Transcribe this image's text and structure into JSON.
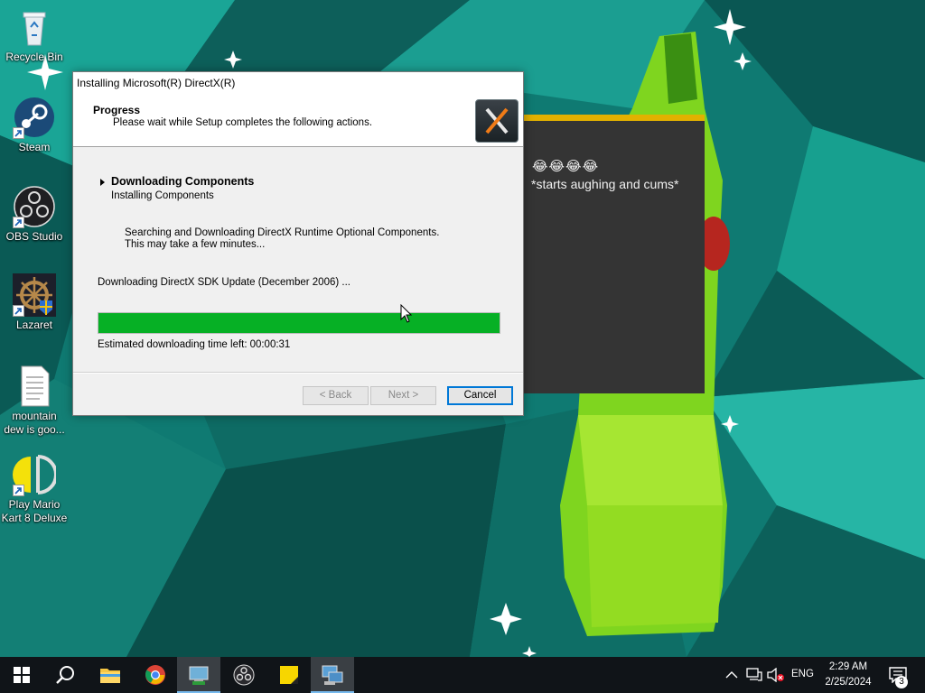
{
  "desktop": {
    "icons": [
      {
        "label": "Recycle Bin",
        "shortcut": false
      },
      {
        "label": "Steam",
        "shortcut": true
      },
      {
        "label": "OBS Studio",
        "shortcut": true
      },
      {
        "label": "Lazaret",
        "shortcut": true
      },
      {
        "label_line1": "mountain",
        "label_line2": "dew is goo...",
        "shortcut": false
      },
      {
        "label_line1": "Play Mario",
        "label_line2": "Kart 8 Deluxe",
        "shortcut": true
      }
    ]
  },
  "chat_popup": {
    "emojis": "😂😂😂😂",
    "message": "*starts aughing and cums*",
    "accent_color": "#e2b100"
  },
  "dialog": {
    "title": "Installing Microsoft(R) DirectX(R)",
    "header_title": "Progress",
    "header_subtitle": "Please wait while Setup completes the following actions.",
    "step_title": "Downloading Components",
    "step_subtitle": "Installing Components",
    "info_line1": "Searching and Downloading DirectX Runtime Optional Components.",
    "info_line2": "This may take a few minutes...",
    "download_status": "Downloading DirectX SDK Update (December 2006) ...",
    "progress_fraction": 1.0,
    "progress_color": "#06b025",
    "eta_label": "Estimated downloading time left:",
    "eta_value": "00:00:31",
    "buttons": {
      "back": "< Back",
      "next": "Next >",
      "cancel": "Cancel"
    }
  },
  "taskbar": {
    "items": [
      "start-icon",
      "search-icon",
      "file-explorer-icon",
      "chrome-icon",
      "setup-app-icon",
      "obs-icon",
      "sticky-notes-icon",
      "directx-setup-icon"
    ],
    "language": "ENG",
    "time": "2:29 AM",
    "date": "2/25/2024",
    "notification_count": "3"
  }
}
